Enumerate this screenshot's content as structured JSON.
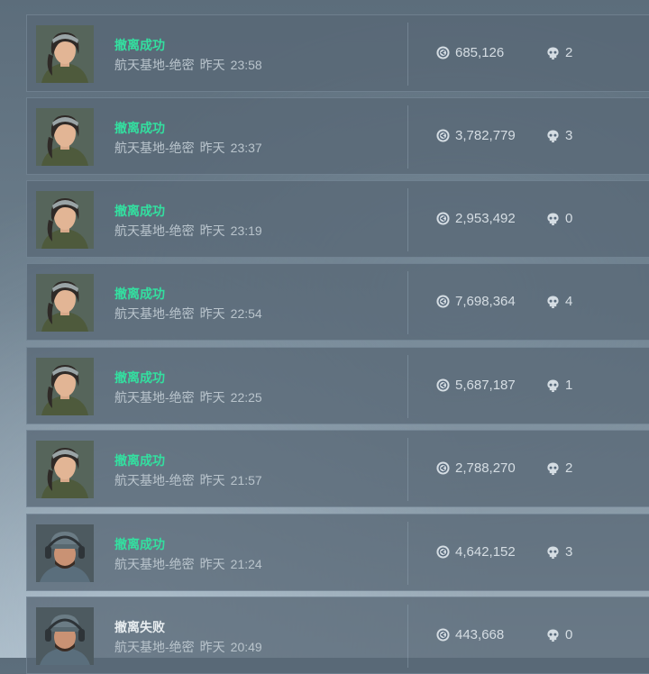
{
  "records": [
    {
      "status": "撤离成功",
      "success": true,
      "map": "航天基地-绝密",
      "day": "昨天",
      "time": "23:58",
      "value": "685,126",
      "kills": "2",
      "avatar": "female-operator-avatar"
    },
    {
      "status": "撤离成功",
      "success": true,
      "map": "航天基地-绝密",
      "day": "昨天",
      "time": "23:37",
      "value": "3,782,779",
      "kills": "3",
      "avatar": "female-operator-avatar"
    },
    {
      "status": "撤离成功",
      "success": true,
      "map": "航天基地-绝密",
      "day": "昨天",
      "time": "23:19",
      "value": "2,953,492",
      "kills": "0",
      "avatar": "female-operator-avatar"
    },
    {
      "status": "撤离成功",
      "success": true,
      "map": "航天基地-绝密",
      "day": "昨天",
      "time": "22:54",
      "value": "7,698,364",
      "kills": "4",
      "avatar": "female-operator-avatar"
    },
    {
      "status": "撤离成功",
      "success": true,
      "map": "航天基地-绝密",
      "day": "昨天",
      "time": "22:25",
      "value": "5,687,187",
      "kills": "1",
      "avatar": "female-operator-avatar"
    },
    {
      "status": "撤离成功",
      "success": true,
      "map": "航天基地-绝密",
      "day": "昨天",
      "time": "21:57",
      "value": "2,788,270",
      "kills": "2",
      "avatar": "female-operator-avatar"
    },
    {
      "status": "撤离成功",
      "success": true,
      "map": "航天基地-绝密",
      "day": "昨天",
      "time": "21:24",
      "value": "4,642,152",
      "kills": "3",
      "avatar": "male-operator-avatar"
    },
    {
      "status": "撤离失败",
      "success": false,
      "map": "航天基地-绝密",
      "day": "昨天",
      "time": "20:49",
      "value": "443,668",
      "kills": "0",
      "avatar": "male-operator-avatar"
    }
  ],
  "colors": {
    "success": "#33e0a0",
    "fail": "#e8edf0"
  },
  "icons": {
    "value": "coin-icon",
    "kills": "skull-icon"
  }
}
